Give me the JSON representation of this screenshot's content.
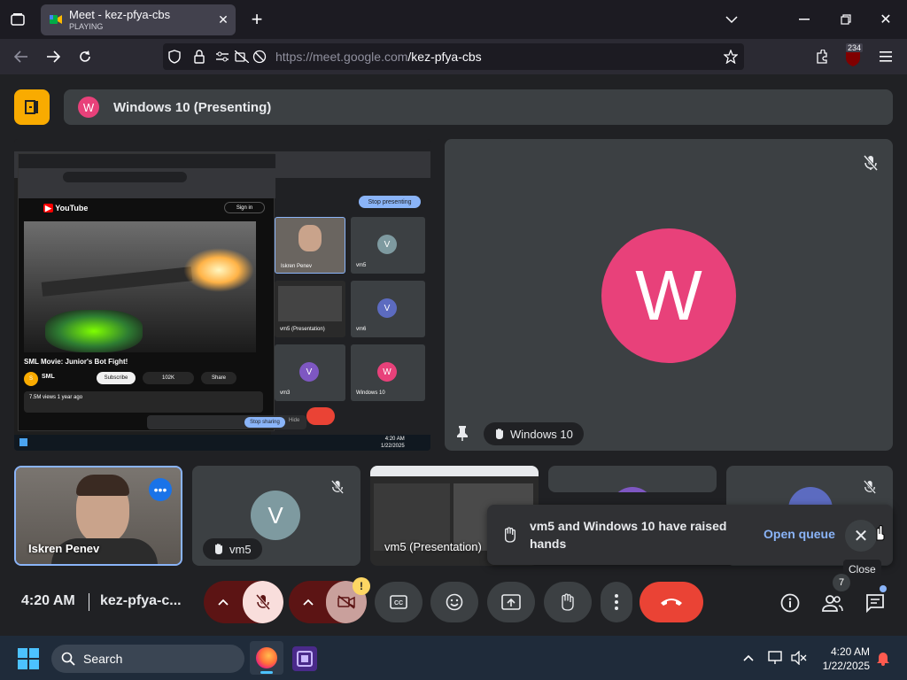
{
  "browser": {
    "tab_title": "Meet - kez-pfya-cbs",
    "tab_status": "PLAYING",
    "url_host": "https://meet.google.com",
    "url_path": "/kez-pfya-cbs",
    "extension_badge": "234"
  },
  "meet": {
    "presenter_banner": "Windows 10 (Presenting)",
    "presenter_initial": "W",
    "big_avatar_initial": "W",
    "big_tile_name": "Windows 10",
    "participants": [
      {
        "name": "Iskren Penev"
      },
      {
        "name": "vm5",
        "initial": "V"
      },
      {
        "name": "vm5 (Presentation)"
      }
    ],
    "toast_text": "vm5 and Windows 10 have raised hands",
    "toast_action": "Open queue",
    "close_tooltip": "Close",
    "time": "4:20 AM",
    "meeting_code": "kez-pfya-c...",
    "people_count": "7",
    "camera_warning": "!"
  },
  "shared_screen": {
    "video_title": "SML Movie: Junior's Bot Fight!",
    "channel": "SML",
    "subscribe": "Subscribe",
    "likes": "102K",
    "share": "Share",
    "views": "7.5M views  1 year ago",
    "stop_presenting": "Stop presenting",
    "stop_sharing": "Stop sharing",
    "hide": "Hide",
    "inner_names": [
      "Iskren Penev",
      "vm5",
      "vm5 (Presentation)",
      "vm6",
      "vm3",
      "Windows 10"
    ],
    "clock_time": "4:20 AM",
    "clock_date": "1/22/2025",
    "youtube_label": "YouTube",
    "sign_in": "Sign in"
  },
  "taskbar": {
    "search": "Search",
    "time": "4:20 AM",
    "date": "1/22/2025"
  },
  "colors": {
    "meet_bg": "#202124",
    "tile_bg": "#3c4043",
    "accent_blue": "#8ab4f8",
    "end_call_red": "#ea4335",
    "avatar_pink": "#e8417a",
    "avatar_slate": "#7e9aa0",
    "meet_logo_yellow": "#f9ab00"
  }
}
